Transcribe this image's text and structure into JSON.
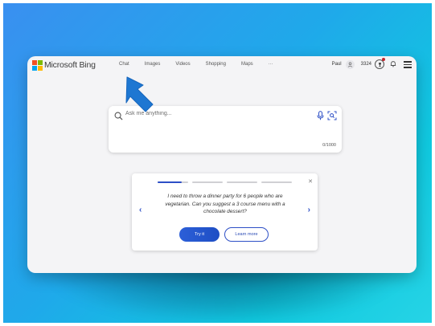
{
  "brand": {
    "name": "Microsoft Bing",
    "logo_colors": [
      "#f25022",
      "#7fba00",
      "#00a4ef",
      "#ffb900"
    ]
  },
  "nav": {
    "items": [
      {
        "label": "Chat"
      },
      {
        "label": "Images"
      },
      {
        "label": "Videos"
      },
      {
        "label": "Shopping"
      },
      {
        "label": "Maps"
      },
      {
        "label": "···"
      }
    ]
  },
  "user": {
    "name": "Paul",
    "points": "3324"
  },
  "search": {
    "placeholder": "Ask me anything...",
    "char_count": "0/1000"
  },
  "suggestion": {
    "text": "I need to throw a dinner party for 6 people who are vegetarian. Can you suggest a 3 course menu with a chocolate dessert?",
    "try_label": "Try it",
    "learn_label": "Learn more",
    "step_count": 4,
    "current_step": 1
  },
  "colors": {
    "accent": "#2d4fc6",
    "arrow": "#1e77d2",
    "notification": "#c4262e"
  }
}
